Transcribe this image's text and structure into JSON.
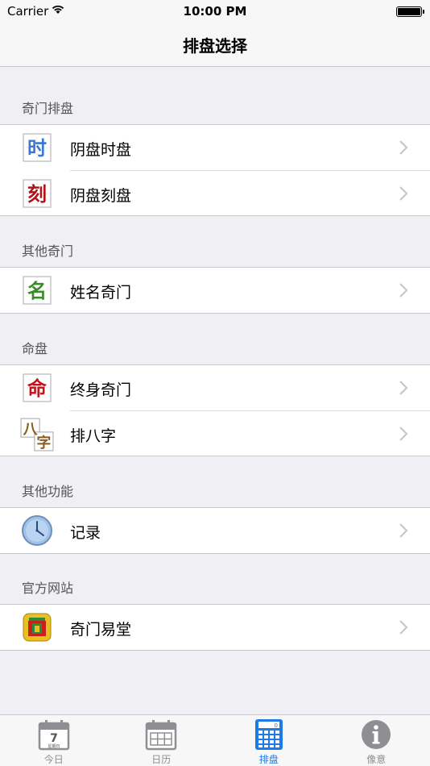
{
  "status_bar": {
    "carrier": "Carrier",
    "time": "10:00 PM"
  },
  "nav": {
    "title": "排盘选择"
  },
  "sections": [
    {
      "header": "奇门排盘",
      "items": [
        {
          "label": "阴盘时盘",
          "icon": "shi-glyph-icon",
          "glyph": "时"
        },
        {
          "label": "阴盘刻盘",
          "icon": "ke-glyph-icon",
          "glyph": "刻"
        }
      ]
    },
    {
      "header": "其他奇门",
      "items": [
        {
          "label": "姓名奇门",
          "icon": "ming-name-glyph-icon",
          "glyph": "名"
        }
      ]
    },
    {
      "header": "命盘",
      "items": [
        {
          "label": "终身奇门",
          "icon": "ming-fate-glyph-icon",
          "glyph": "命"
        },
        {
          "label": "排八字",
          "icon": "bazi-glyph-icon",
          "glyph1": "八",
          "glyph2": "字"
        }
      ]
    },
    {
      "header": "其他功能",
      "items": [
        {
          "label": "记录",
          "icon": "clock-icon"
        }
      ]
    },
    {
      "header": "官方网站",
      "items": [
        {
          "label": "奇门易堂",
          "icon": "app-logo-icon"
        }
      ]
    }
  ],
  "tabs": [
    {
      "label": "今日",
      "icon": "calendar-day-icon",
      "day": "7",
      "sub": "星期日"
    },
    {
      "label": "日历",
      "icon": "calendar-grid-icon"
    },
    {
      "label": "排盘",
      "icon": "calculator-icon",
      "active": true,
      "display": "0"
    },
    {
      "label": "像意",
      "icon": "info-icon"
    }
  ],
  "colors": {
    "accent": "#1e7ae6",
    "shi": "#3a78d0",
    "ke": "#b01218",
    "ming_name": "#3a8a2a",
    "ming_fate": "#c4121a",
    "bazi": "#8a5a1e"
  }
}
